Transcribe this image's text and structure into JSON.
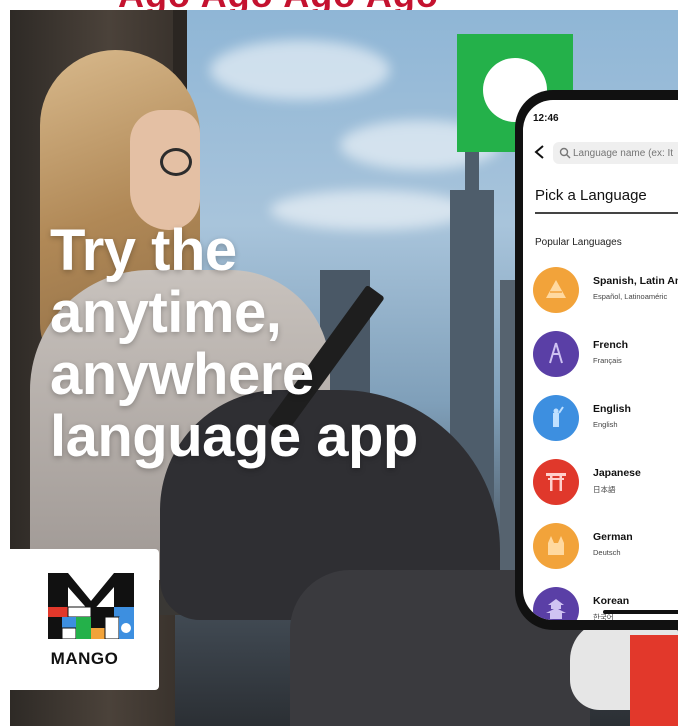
{
  "top_strip": {
    "text": "Ago Ago Ago Ago"
  },
  "ad": {
    "headline": [
      "Try the",
      "anytime,",
      "anywhere",
      "language app"
    ],
    "brand": "MANGO"
  },
  "phone": {
    "time": "12:46",
    "search_placeholder": "Language name (ex: It",
    "title": "Pick a Language",
    "section_label": "Popular Languages",
    "languages": [
      {
        "name": "Spanish, Latin Am",
        "native": "Español, Latinoaméric",
        "color": "#f2a33a",
        "icon": "pyramid-icon"
      },
      {
        "name": "French",
        "native": "Français",
        "color": "#5a3fa6",
        "icon": "eiffel-tower-icon"
      },
      {
        "name": "English",
        "native": "English",
        "color": "#3d8fe0",
        "icon": "statue-of-liberty-icon"
      },
      {
        "name": "Japanese",
        "native": "日本語",
        "color": "#e0382b",
        "icon": "torii-gate-icon"
      },
      {
        "name": "German",
        "native": "Deutsch",
        "color": "#f2a33a",
        "icon": "castle-icon"
      },
      {
        "name": "Korean",
        "native": "한국어",
        "color": "#5a3fa6",
        "icon": "pagoda-icon"
      }
    ]
  },
  "colors": {
    "brand_green": "#24b14a",
    "headline": "#ffffff",
    "accent_red": "#e2382b"
  }
}
